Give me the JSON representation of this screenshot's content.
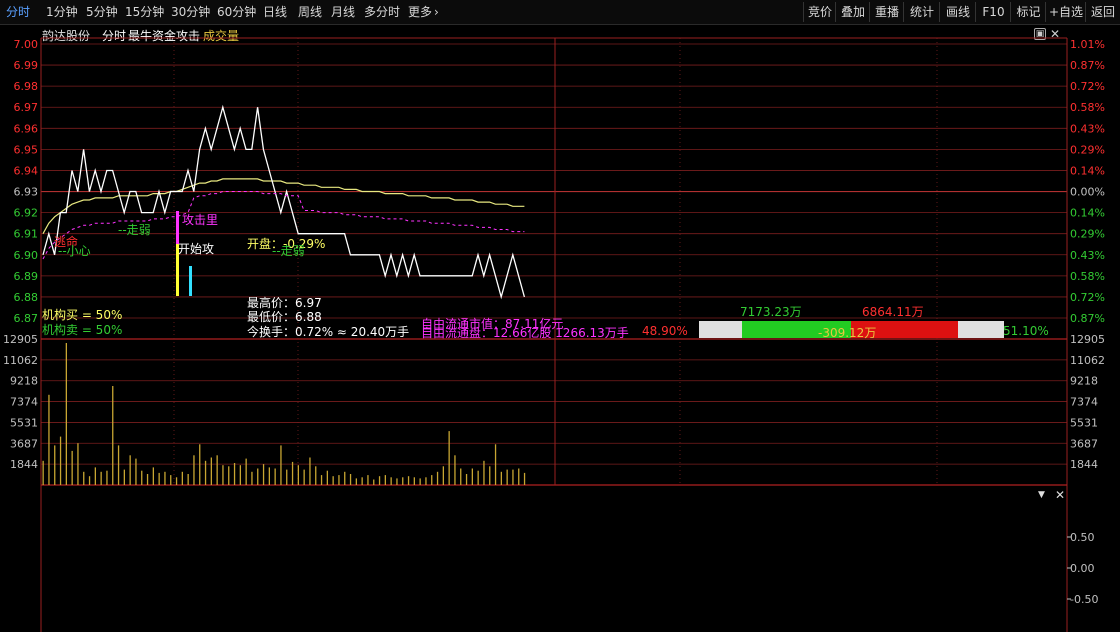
{
  "toolbar": {
    "periods": [
      {
        "label": "分时",
        "active": true
      },
      {
        "label": "1分钟"
      },
      {
        "label": "5分钟"
      },
      {
        "label": "15分钟"
      },
      {
        "label": "30分钟"
      },
      {
        "label": "60分钟"
      },
      {
        "label": "日线"
      },
      {
        "label": "周线"
      },
      {
        "label": "月线"
      },
      {
        "label": "多分时"
      },
      {
        "label": "更多"
      }
    ],
    "more_chevron": "chevron-right-icon",
    "right_buttons": [
      "竞价",
      "叠加",
      "重播",
      "统计",
      "画线",
      "F10",
      "标记",
      "+自选",
      "返回"
    ]
  },
  "header": {
    "stock_name": "韵达股份",
    "mode": "分时",
    "indicator": "最牛资金攻击",
    "volume_label": "成交量",
    "restore_icon": "restore-icon",
    "close_icon": "close-icon"
  },
  "colors": {
    "up": "#ff3030",
    "down": "#33cc33",
    "price": "#ffffff",
    "avg": "#e8e880",
    "grid": "#7a1e1e",
    "magenta": "#ff33ff",
    "volume": "#c8a632"
  },
  "price_axis": {
    "labels": [
      "7.00",
      "6.99",
      "6.98",
      "6.97",
      "6.96",
      "6.95",
      "6.94",
      "6.93",
      "6.92",
      "6.91",
      "6.90",
      "6.89",
      "6.88",
      "6.87"
    ],
    "pct_labels": [
      "1.01%",
      "0.87%",
      "0.72%",
      "0.58%",
      "0.43%",
      "0.29%",
      "0.14%",
      "0.00%",
      "0.14%",
      "0.29%",
      "0.43%",
      "0.58%",
      "0.72%",
      "0.87%"
    ]
  },
  "volume_axis": {
    "labels": [
      "12905",
      "11062",
      "9218",
      "7374",
      "5531",
      "3687",
      "1844"
    ]
  },
  "indicator_axis": {
    "labels": [
      "0.50",
      "0.00",
      "-0.50"
    ]
  },
  "annotations": {
    "sell_point": "逃命",
    "careful": "--小心",
    "weak_left": "--走弱",
    "attack": "攻击里",
    "start_attack": "开始攻",
    "open_text": "开盘：-0.29%",
    "weak_right": "--走弱",
    "inst_buy": "机构买 = 50%",
    "inst_sell": "机构卖 = 50%",
    "high": "最高价：6.97",
    "low": "最低价：6.88",
    "turnover": "今换手：0.72% ≈ 20.40万手",
    "float_mktcap": "自由流通市值：87.11亿元",
    "float_shares": "自由流通盘：12.66亿股  1266.13万手",
    "buy_pct": "48.90%",
    "buy_amount": "7173.23万",
    "sell_amount": "6864.11万",
    "net_amount": "-309.12万",
    "sell_pct": "51.10%"
  },
  "chart_data": {
    "type": "line",
    "title": "分时",
    "y_range": [
      6.87,
      7.0
    ],
    "prev_close": 6.93,
    "series": [
      {
        "values": [
          6.9,
          6.91,
          6.9,
          6.92,
          6.92,
          6.94,
          6.93,
          6.95,
          6.93,
          6.94,
          6.93,
          6.94,
          6.94,
          6.93,
          6.92,
          6.93,
          6.93,
          6.92,
          6.92,
          6.92,
          6.93,
          6.92,
          6.93,
          6.93,
          6.93,
          6.94,
          6.93,
          6.95,
          6.96,
          6.95,
          6.96,
          6.97,
          6.96,
          6.95,
          6.96,
          6.95,
          6.95,
          6.97,
          6.95,
          6.94,
          6.93,
          6.92,
          6.93,
          6.92,
          6.91,
          6.91,
          6.91,
          6.91,
          6.91,
          6.91,
          6.91,
          6.91,
          6.91,
          6.9,
          6.9,
          6.9,
          6.9,
          6.9,
          6.9,
          6.89,
          6.9,
          6.89,
          6.9,
          6.89,
          6.9,
          6.89,
          6.89,
          6.89,
          6.89,
          6.89,
          6.89,
          6.89,
          6.89,
          6.89,
          6.89,
          6.9,
          6.89,
          6.9,
          6.89,
          6.88,
          6.89,
          6.9,
          6.89,
          6.88
        ]
      },
      {
        "values": [
          6.91,
          6.915,
          6.918,
          6.92,
          6.922,
          6.924,
          6.925,
          6.926,
          6.926,
          6.927,
          6.927,
          6.927,
          6.927,
          6.928,
          6.928,
          6.928,
          6.928,
          6.928,
          6.928,
          6.929,
          6.929,
          6.929,
          6.93,
          6.93,
          6.931,
          6.932,
          6.933,
          6.934,
          6.934,
          6.935,
          6.935,
          6.936,
          6.936,
          6.936,
          6.936,
          6.936,
          6.936,
          6.936,
          6.935,
          6.935,
          6.935,
          6.935,
          6.934,
          6.934,
          6.934,
          6.933,
          6.933,
          6.933,
          6.932,
          6.932,
          6.932,
          6.932,
          6.931,
          6.931,
          6.931,
          6.93,
          6.93,
          6.93,
          6.93,
          6.929,
          6.929,
          6.929,
          6.929,
          6.928,
          6.928,
          6.928,
          6.928,
          6.927,
          6.927,
          6.927,
          6.927,
          6.926,
          6.926,
          6.926,
          6.926,
          6.925,
          6.925,
          6.925,
          6.924,
          6.924,
          6.924,
          6.923,
          6.923,
          6.923
        ]
      }
    ],
    "volume": [
      2200,
      8200,
      3600,
      4400,
      12905,
      3100,
      3800,
      1200,
      800,
      1600,
      1200,
      1300,
      9000,
      3600,
      1400,
      2700,
      2400,
      1300,
      1000,
      1600,
      1100,
      1200,
      900,
      700,
      1200,
      1000,
      2700,
      3700,
      2200,
      2500,
      2700,
      1800,
      1700,
      2000,
      1800,
      2400,
      1200,
      1500,
      1900,
      1600,
      1500,
      3600,
      1400,
      2100,
      1800,
      1400,
      2500,
      1700,
      900,
      1300,
      800,
      900,
      1200,
      1000,
      600,
      700,
      900,
      500,
      800,
      900,
      700,
      600,
      700,
      800,
      700,
      600,
      700,
      900,
      1200,
      1700,
      4900,
      2700,
      1500,
      1000,
      1500,
      1300,
      2200,
      1700,
      3700,
      1200,
      1400,
      1400,
      1500,
      1100
    ]
  }
}
